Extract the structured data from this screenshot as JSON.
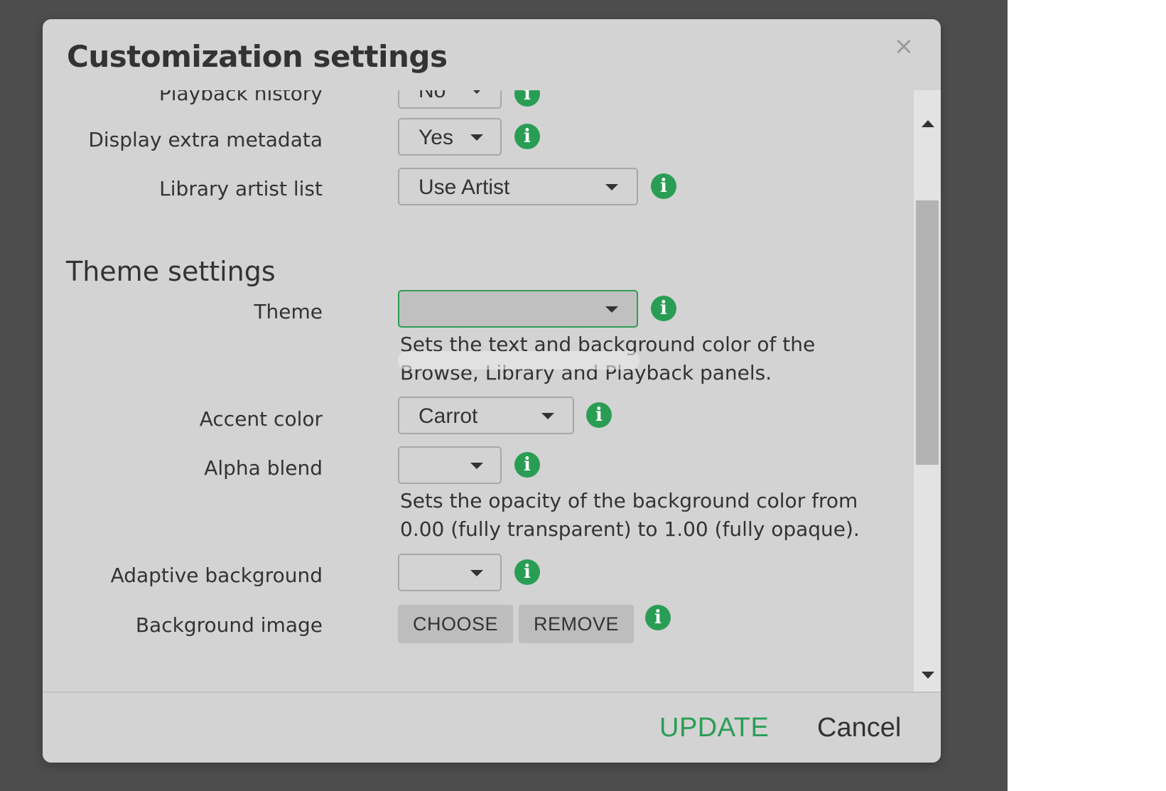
{
  "dialog": {
    "title": "Customization settings",
    "close_glyph": "×"
  },
  "general": {
    "playback_history": {
      "label": "Playback history",
      "value": "No"
    },
    "display_extra_metadata": {
      "label": "Display extra metadata",
      "value": "Yes"
    },
    "library_artist_list": {
      "label": "Library artist list",
      "value": "Use Artist"
    }
  },
  "theme_section": {
    "title": "Theme settings",
    "theme": {
      "label": "Theme",
      "value": "",
      "help": "Sets the text and background color of the Browse, Library and Playback panels."
    },
    "accent_color": {
      "label": "Accent color",
      "value": "Carrot"
    },
    "alpha_blend": {
      "label": "Alpha blend",
      "value": "",
      "help": "Sets the opacity of the background color from 0.00 (fully transparent) to 1.00 (fully opaque)."
    },
    "adaptive_background": {
      "label": "Adaptive background",
      "value": ""
    },
    "background_image": {
      "label": "Background image",
      "choose_label": "CHOOSE",
      "remove_label": "REMOVE"
    }
  },
  "footer": {
    "update_label": "UPDATE",
    "cancel_label": "Cancel"
  },
  "icons": {
    "info": "info-icon",
    "caret": "caret-down-icon",
    "close": "close-icon"
  },
  "colors": {
    "accent": "#2a9d55",
    "backdrop": "#4d4d4d",
    "dialog_bg": "#d3d3d3"
  }
}
